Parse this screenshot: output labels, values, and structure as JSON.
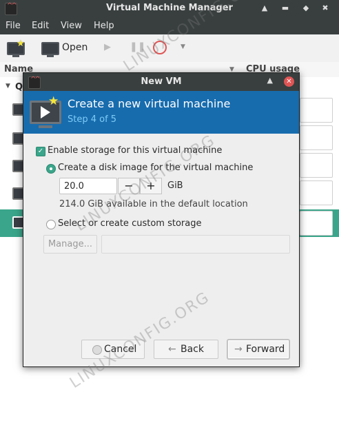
{
  "main_window": {
    "title": "Virtual Machine Manager",
    "menu": [
      "File",
      "Edit",
      "View",
      "Help"
    ],
    "toolbar": {
      "open_label": "Open"
    },
    "columns": {
      "name": "Name",
      "cpu": "CPU usage"
    },
    "group_label": "Q"
  },
  "dialog": {
    "title": "New VM",
    "header_title": "Create a new virtual machine",
    "header_step": "Step 4 of 5",
    "enable_storage_label": "Enable storage for this virtual machine",
    "enable_storage_checked": true,
    "create_disk_label": "Create a disk image for the virtual machine",
    "create_disk_selected": true,
    "disk_size_value": "20.0",
    "disk_size_unit": "GiB",
    "decrement_symbol": "−",
    "increment_symbol": "+",
    "available_text": "214.0 GiB available in the default location",
    "custom_storage_label": "Select or create custom storage",
    "custom_storage_selected": false,
    "manage_label": "Manage...",
    "buttons": {
      "cancel": "Cancel",
      "back": "Back",
      "forward": "Forward"
    }
  },
  "watermark": "LINUXCONFIG.ORG",
  "colors": {
    "titlebar": "#393f3f",
    "header_blue": "#176cae",
    "accent_green": "#3aa58a",
    "step_text": "#7ecbf5"
  }
}
